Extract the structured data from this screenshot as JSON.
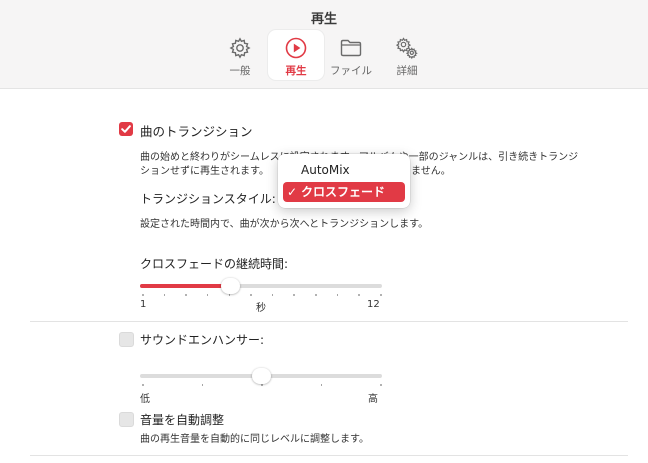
{
  "window": {
    "title": "再生"
  },
  "tabs": [
    {
      "label": "一般",
      "icon": "gear-icon"
    },
    {
      "label": "再生",
      "icon": "play-circle-icon",
      "active": true
    },
    {
      "label": "ファイル",
      "icon": "folder-icon"
    },
    {
      "label": "詳細",
      "icon": "gears-icon"
    }
  ],
  "crossfade_section": {
    "checkbox_label": "曲のトランジション",
    "checked": true,
    "description_line1": "曲の始めと終わりがシームレスに設定されます。アルバムや一部のジャンルは、引き続きトランジ",
    "description_line2": "ションせずに再生されます。",
    "description_line2_tail": "ません。",
    "style_label": "トランジションスタイル:",
    "style_description": "設定された時間内で、曲が次から次へとトランジションします。",
    "duration_label": "クロスフェードの継続時間:",
    "slider": {
      "min_label": "1",
      "unit_label": "秒",
      "max_label": "12",
      "min": 1,
      "max": 12,
      "value": 5
    }
  },
  "style_popup": {
    "options": [
      {
        "label": "AutoMix",
        "selected": false
      },
      {
        "label": "クロスフェード",
        "selected": true
      }
    ],
    "check_glyph": "✓"
  },
  "sound_enhancer": {
    "checkbox_label": "サウンドエンハンサー:",
    "checked": false,
    "slider": {
      "min_label": "低",
      "max_label": "高",
      "value_fraction": 0.5
    }
  },
  "volume_adjust": {
    "checkbox_label": "音量を自動調整",
    "checked": false,
    "description": "曲の再生音量を自動的に同じレベルに調整します。"
  },
  "colors": {
    "accent": "#e13a45",
    "track": "#dcdcdc"
  }
}
